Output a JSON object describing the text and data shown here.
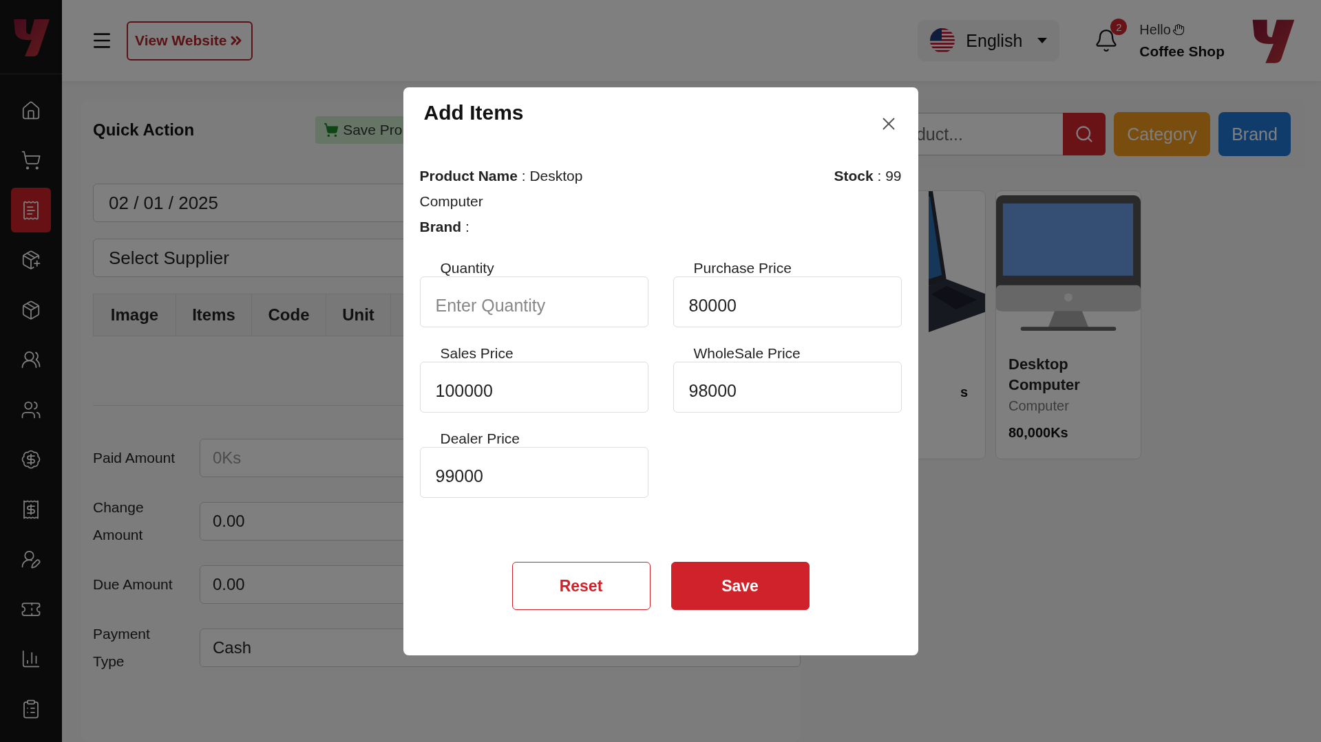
{
  "header": {
    "view_website": "View Website",
    "language": "English",
    "notifications": "2",
    "greeting": "Hello",
    "user_name": "Coffee Shop"
  },
  "sidebar": {
    "items": [
      {
        "selected": false
      },
      {
        "selected": false
      },
      {
        "selected": true
      },
      {
        "selected": false
      },
      {
        "selected": false
      },
      {
        "selected": false
      },
      {
        "selected": false
      },
      {
        "selected": false
      },
      {
        "selected": false
      },
      {
        "selected": false
      },
      {
        "selected": false
      },
      {
        "selected": false
      },
      {
        "selected": false
      }
    ]
  },
  "quick_action": {
    "title": "Quick Action",
    "save_button": "Save Pro",
    "date": "02 / 01 / 2025",
    "supplier": "Select Supplier",
    "table_columns": [
      "Image",
      "Items",
      "Code",
      "Unit"
    ],
    "payment": [
      {
        "label": "Paid Amount",
        "placeholder": "0Ks"
      },
      {
        "label": "Change Amount",
        "value": "0.00"
      },
      {
        "label": "Due Amount",
        "value": "0.00"
      },
      {
        "label": "Payment Type",
        "value": "Cash"
      }
    ]
  },
  "products": {
    "search_placeholder": "duct...",
    "category_button": "Category",
    "brand_button": "Brand",
    "cards": [
      {
        "kind": "partial",
        "price": "s"
      },
      {
        "kind": "full",
        "name": "Desktop Computer",
        "category": "Computer",
        "price": "80,000Ks"
      }
    ]
  },
  "modal": {
    "title": "Add Items",
    "product_name": "**Product Name** : Desktop Computer",
    "brand": "**Brand** :",
    "stock": "**Stock** : 99",
    "fields": [
      {
        "label": "Quantity",
        "placeholder": "Enter Quantity"
      },
      {
        "label": "Purchase Price",
        "value": "80000"
      },
      {
        "label": "Sales Price",
        "value": "100000"
      },
      {
        "label": "WholeSale Price",
        "value": "98000"
      },
      {
        "label": "Dealer Price",
        "value": "99000"
      }
    ],
    "buttons": [
      {
        "label": "Reset",
        "kind": "outline"
      },
      {
        "label": "Save",
        "kind": "primary"
      }
    ]
  }
}
